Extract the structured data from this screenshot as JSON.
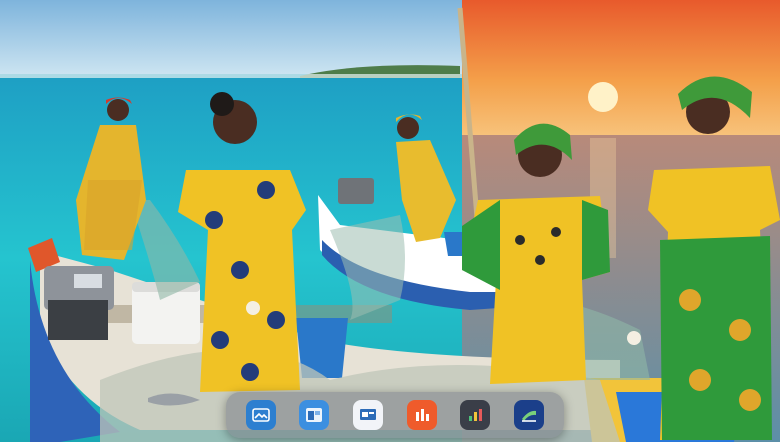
{
  "dock": {
    "apps": [
      {
        "icon": "photo-editor-icon",
        "color": "#2d7fd0"
      },
      {
        "icon": "window-manager-icon",
        "color": "#3c8fe0"
      },
      {
        "icon": "presentation-icon",
        "color": "#f2f4f8"
      },
      {
        "icon": "bar-chart-icon",
        "color": "#ef5b2b"
      },
      {
        "icon": "stats-icon",
        "color": "#3a3e48"
      },
      {
        "icon": "finance-icon",
        "color": "#1b3f8a"
      }
    ]
  },
  "wallpaper": {
    "icon": "beach-scene-wallpaper",
    "sky_color": "#9cc8e6",
    "sea_color": "#1fb3c9",
    "sunset_color": "#f07a38"
  }
}
